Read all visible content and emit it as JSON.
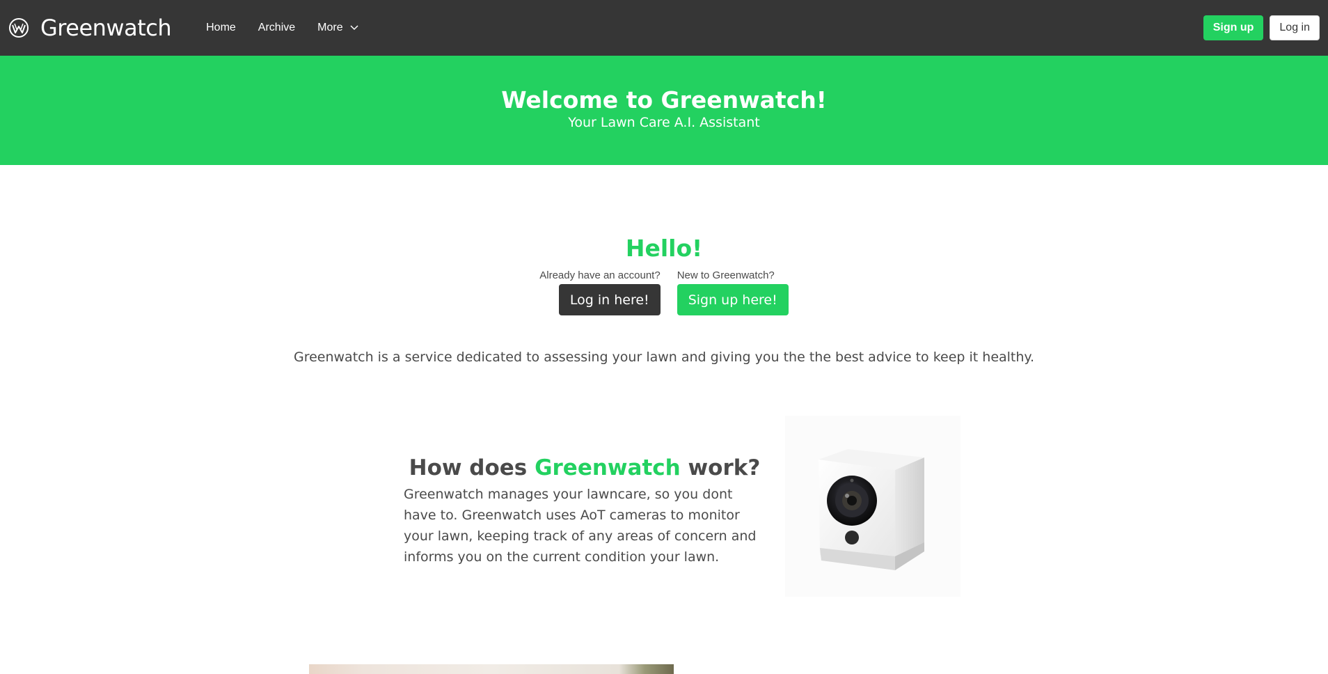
{
  "navbar": {
    "brand": "Greenwatch",
    "links": [
      "Home",
      "Archive",
      "More"
    ],
    "signup_label": "Sign up",
    "login_label": "Log in"
  },
  "hero": {
    "title": "Welcome to Greenwatch!",
    "subtitle": "Your Lawn Care A.I. Assistant"
  },
  "hello": {
    "title": "Hello!",
    "existing_prompt": "Already have an account?",
    "login_button": "Log in here!",
    "new_prompt": "New to Greenwatch?",
    "signup_button": "Sign up here!"
  },
  "intro": "Greenwatch is a service dedicated to assessing your lawn and giving you the the best advice to keep it healthy.",
  "how": {
    "title_pre": "How does ",
    "title_accent": "Greenwatch",
    "title_post": " work?",
    "body": "Greenwatch manages your lawncare, so you dont have to. Greenwatch uses AoT cameras to monitor your lawn, keeping track of any areas of concern and informs you on the current condition your lawn."
  },
  "colors": {
    "navbar": "#363636",
    "accent": "#23d160",
    "text": "#4a4a4a"
  },
  "icons": {
    "logo": "greenwatch-logo-icon",
    "dropdown": "chevron-down-icon"
  }
}
